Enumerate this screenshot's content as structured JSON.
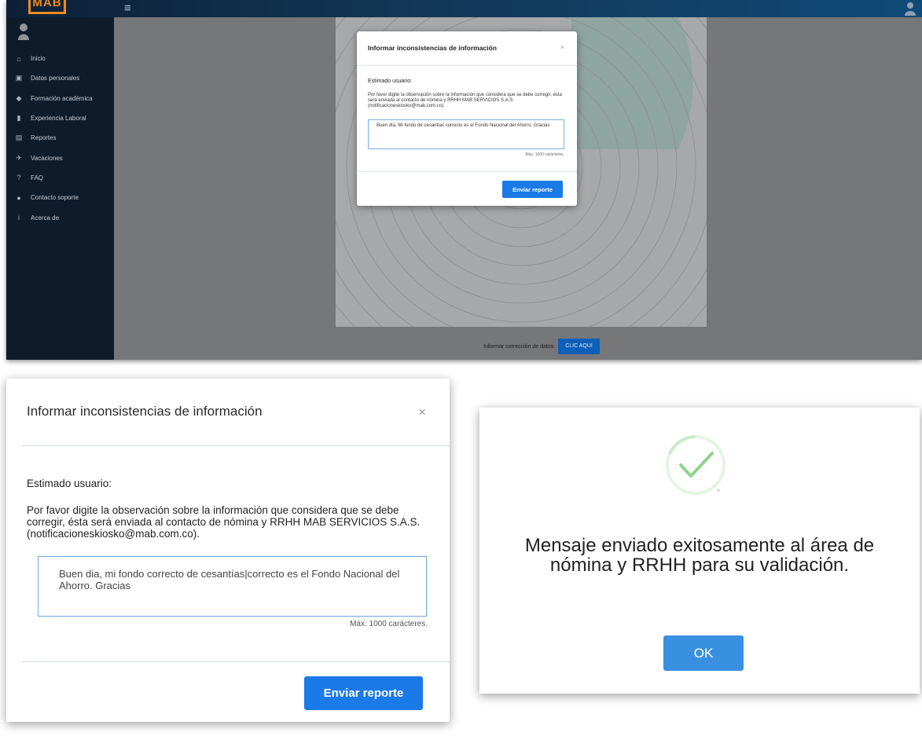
{
  "app": {
    "logo_text": "MAB",
    "hamburger_glyph": "≡",
    "sidebar": {
      "items": [
        {
          "label": "Inicio",
          "icon": "home-icon",
          "glyph": "⌂"
        },
        {
          "label": "Datos personales",
          "icon": "id-card-icon",
          "glyph": "▣"
        },
        {
          "label": "Formación académica",
          "icon": "graduation-cap-icon",
          "glyph": "◆"
        },
        {
          "label": "Experiencia Laboral",
          "icon": "building-icon",
          "glyph": "▮"
        },
        {
          "label": "Reportes",
          "icon": "file-icon",
          "glyph": "▤"
        },
        {
          "label": "Vacaciones",
          "icon": "plane-icon",
          "glyph": "✈"
        },
        {
          "label": "FAQ",
          "icon": "question-icon",
          "glyph": "?"
        },
        {
          "label": "Contacto soporte",
          "icon": "chat-icon",
          "glyph": "●"
        },
        {
          "label": "Acerca de",
          "icon": "info-icon",
          "glyph": "i"
        }
      ]
    },
    "bottom_bar": {
      "label": "Informar corrección de datos:",
      "button": "CLIC AQUI"
    }
  },
  "mini_modal": {
    "title": "Informar inconsistencias de información",
    "close": "×",
    "greeting": "Estimado usuario:",
    "description": "Por favor digite la observación sobre la información que considera que se debe corregir, ésta será enviada al contacto de nómina y RRHH MAB SERVICIOS S.A.S. (notificacioneskiosko@mab.com.co).",
    "textarea_value": "Buen día, Mi fondo de cesantías correcto es el Fondo Nacional del Ahorro. Gracias",
    "max_chars": "Máx. 1000 carácteres.",
    "send_button": "Enviar reporte"
  },
  "report_modal": {
    "title": "Informar inconsistencias de información",
    "close": "×",
    "greeting": "Estimado usuario:",
    "description": "Por favor digite la observación sobre la información que considera que se debe corregir, ésta será enviada al contacto de nómina y RRHH MAB SERVICIOS S.A.S. (notificacioneskiosko@mab.com.co).",
    "textarea_value": "Buen dia, mi fondo correcto de cesantías|correcto es el Fondo Nacional del Ahorro. Gracias",
    "max_chars": "Máx. 1000 carácteres.",
    "send_button": "Enviar reporte"
  },
  "success_modal": {
    "icon": "check-circle-icon",
    "message": "Mensaje enviado exitosamente al área de nómina y RRHH para su validación.",
    "ok_button": "OK"
  },
  "colors": {
    "brand_orange": "#f08a1c",
    "primary_blue": "#1a7ae8",
    "success_green": "#8fd48b",
    "sidebar_bg": "#0d1b2b"
  }
}
